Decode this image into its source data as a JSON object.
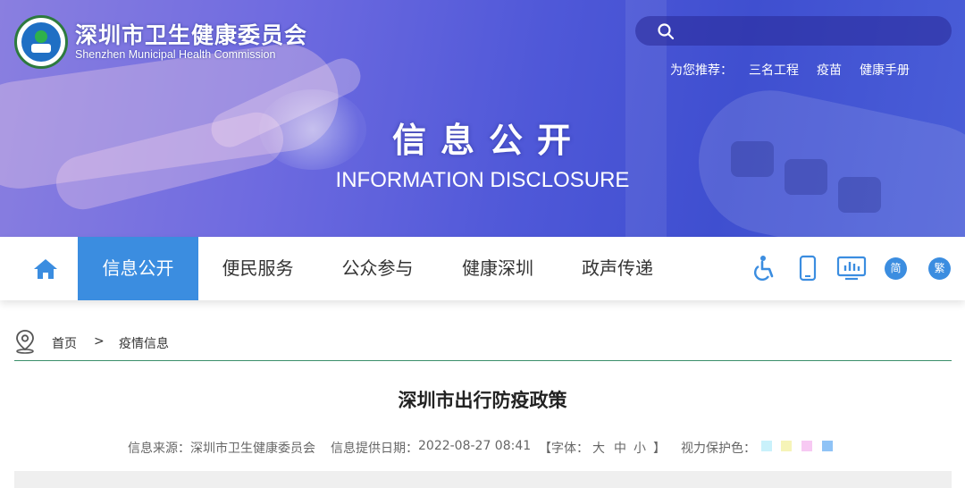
{
  "header": {
    "title_cn": "深圳市卫生健康委员会",
    "title_en": "Shenzhen Municipal Health Commission",
    "search": {
      "placeholder": ""
    },
    "recommend": {
      "label": "为您推荐：",
      "items": [
        "三名工程",
        "疫苗",
        "健康手册"
      ]
    }
  },
  "banner": {
    "title_cn": "信息公开",
    "title_en": "INFORMATION DISCLOSURE"
  },
  "nav": {
    "items": [
      {
        "label": "信息公开",
        "active": true
      },
      {
        "label": "便民服务",
        "active": false
      },
      {
        "label": "公众参与",
        "active": false
      },
      {
        "label": "健康深圳",
        "active": false
      },
      {
        "label": "政声传递",
        "active": false
      }
    ],
    "tools": {
      "accessibility_icon": "wheelchair-icon",
      "mobile_icon": "mobile-phone-icon",
      "data_icon": "bar-chart-icon",
      "simplified": "简",
      "traditional": "繁"
    }
  },
  "breadcrumb": {
    "home": "首页",
    "separator": ">",
    "current": "疫情信息"
  },
  "article": {
    "title": "深圳市出行防疫政策",
    "source_label": "信息来源：",
    "source": "深圳市卫生健康委员会",
    "date_label": "信息提供日期：",
    "date": "2022-08-27 08:41",
    "font_open": "【字体：",
    "font_large": "大",
    "font_medium": "中",
    "font_small": "小",
    "font_close": "】",
    "eye_label": "视力保护色：",
    "eye_colors": [
      "#c9f1fb",
      "#f6f4b8",
      "#f7c9f3",
      "#8fc3f6"
    ]
  },
  "colors": {
    "accent": "#3b8de0",
    "divider": "#3a8f6a"
  }
}
